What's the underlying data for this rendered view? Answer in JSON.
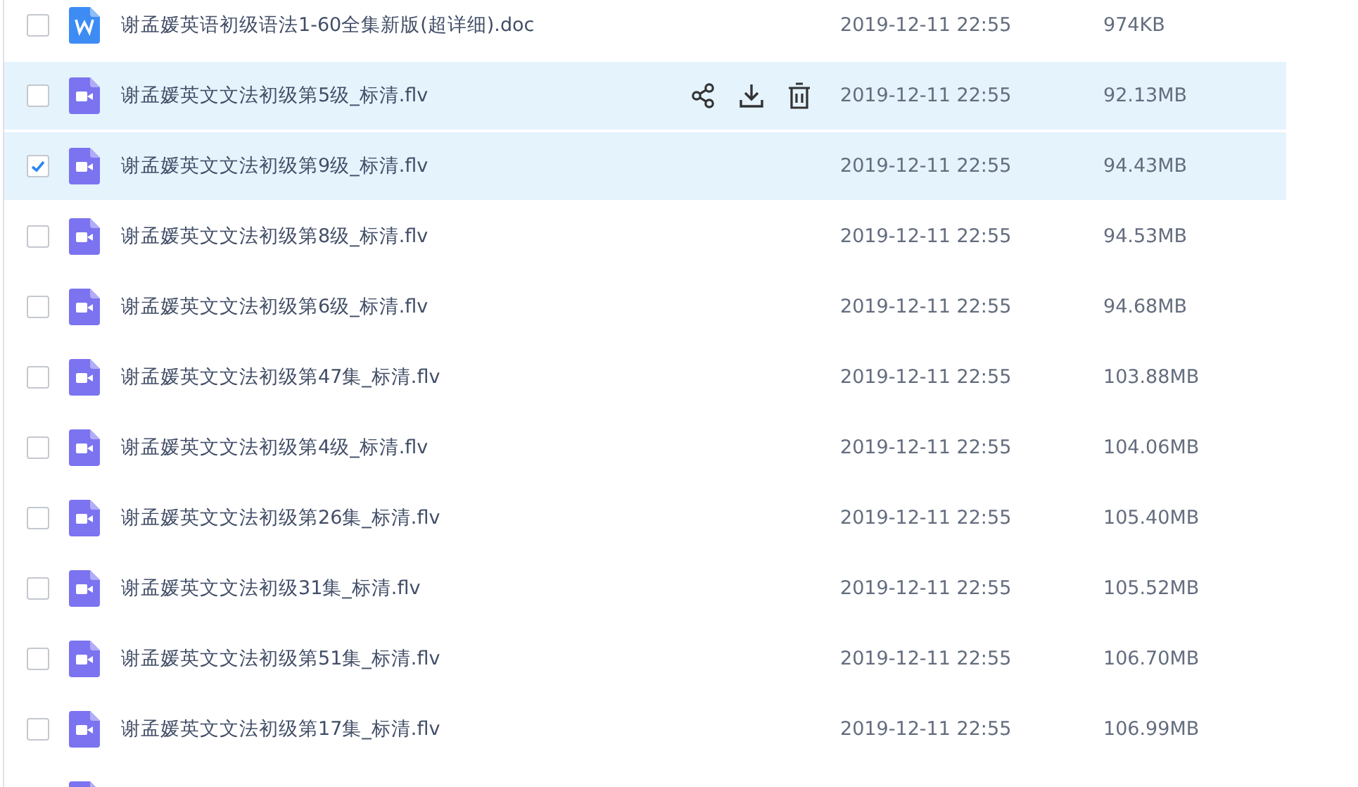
{
  "files": [
    {
      "kind": "doc",
      "name": "谢孟媛英语初级语法1-60全集新版(超详细).doc",
      "date": "2019-12-11 22:55",
      "size": "974KB",
      "checked": false,
      "hovered": false
    },
    {
      "kind": "video",
      "name": "谢孟媛英文文法初级第5级_标清.flv",
      "date": "2019-12-11 22:55",
      "size": "92.13MB",
      "checked": false,
      "hovered": true
    },
    {
      "kind": "video",
      "name": "谢孟媛英文文法初级第9级_标清.flv",
      "date": "2019-12-11 22:55",
      "size": "94.43MB",
      "checked": true,
      "hovered": false
    },
    {
      "kind": "video",
      "name": "谢孟媛英文文法初级第8级_标清.flv",
      "date": "2019-12-11 22:55",
      "size": "94.53MB",
      "checked": false,
      "hovered": false
    },
    {
      "kind": "video",
      "name": "谢孟媛英文文法初级第6级_标清.flv",
      "date": "2019-12-11 22:55",
      "size": "94.68MB",
      "checked": false,
      "hovered": false
    },
    {
      "kind": "video",
      "name": "谢孟媛英文文法初级第47集_标清.flv",
      "date": "2019-12-11 22:55",
      "size": "103.88MB",
      "checked": false,
      "hovered": false
    },
    {
      "kind": "video",
      "name": "谢孟媛英文文法初级第4级_标清.flv",
      "date": "2019-12-11 22:55",
      "size": "104.06MB",
      "checked": false,
      "hovered": false
    },
    {
      "kind": "video",
      "name": "谢孟媛英文文法初级第26集_标清.flv",
      "date": "2019-12-11 22:55",
      "size": "105.40MB",
      "checked": false,
      "hovered": false
    },
    {
      "kind": "video",
      "name": "谢孟媛英文文法初级31集_标清.flv",
      "date": "2019-12-11 22:55",
      "size": "105.52MB",
      "checked": false,
      "hovered": false
    },
    {
      "kind": "video",
      "name": "谢孟媛英文文法初级第51集_标清.flv",
      "date": "2019-12-11 22:55",
      "size": "106.70MB",
      "checked": false,
      "hovered": false
    },
    {
      "kind": "video",
      "name": "谢孟媛英文文法初级第17集_标清.flv",
      "date": "2019-12-11 22:55",
      "size": "106.99MB",
      "checked": false,
      "hovered": false
    },
    {
      "kind": "video"
    }
  ]
}
